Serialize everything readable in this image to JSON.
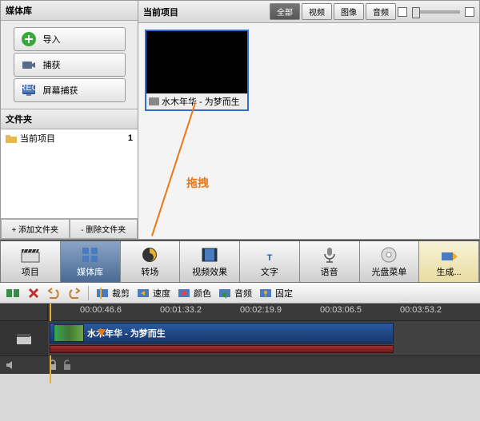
{
  "media": {
    "header": "媒体库",
    "import": "导入",
    "capture": "捕获",
    "screencap": "屏幕捕获",
    "folders_header": "文件夹",
    "folder_name": "当前项目",
    "folder_count": "1",
    "add_folder": "+ 添加文件夹",
    "del_folder": "- 删除文件夹"
  },
  "gallery": {
    "title": "当前项目",
    "filter_all": "全部",
    "filter_video": "视频",
    "filter_image": "图像",
    "filter_audio": "音频",
    "thumb_caption": "水木年华 - 为梦而生",
    "annotation": "拖拽"
  },
  "toolbar": {
    "project": "项目",
    "media": "媒体库",
    "transition": "转场",
    "videofx": "视频效果",
    "text": "文字",
    "voice": "语音",
    "discmenu": "光盘菜单",
    "generate": "生成..."
  },
  "timeline_toolbar": {
    "trim": "裁剪",
    "speed": "速度",
    "color": "颜色",
    "audio": "音频",
    "stable": "固定"
  },
  "ruler": {
    "t0": "00:00:46.6",
    "t1": "00:01:33.2",
    "t2": "00:02:19.9",
    "t3": "00:03:06.5",
    "t4": "00:03:53.2"
  },
  "clip": {
    "title": "水木年华 - 为梦而生"
  }
}
